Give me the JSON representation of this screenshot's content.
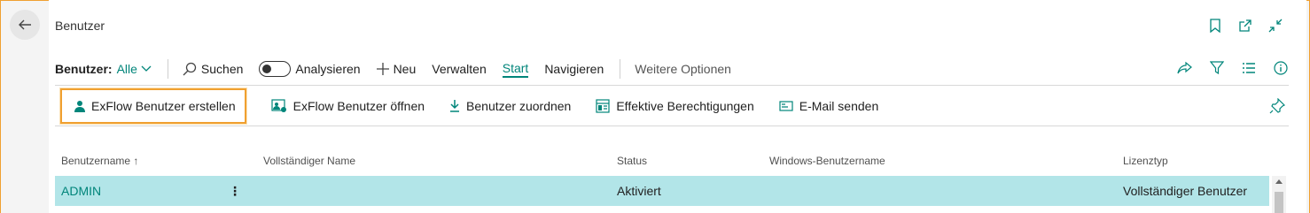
{
  "page": {
    "title": "Benutzer"
  },
  "actionbar": {
    "filter_label": "Benutzer:",
    "filter_value": "Alle",
    "search": "Suchen",
    "analyze": "Analysieren",
    "new": "Neu",
    "manage": "Verwalten",
    "start": "Start",
    "navigate": "Navigieren",
    "more": "Weitere Optionen"
  },
  "promoted": {
    "create": "ExFlow Benutzer erstellen",
    "open": "ExFlow Benutzer öffnen",
    "assign": "Benutzer zuordnen",
    "permissions": "Effektive Berechtigungen",
    "email": "E-Mail senden"
  },
  "table": {
    "columns": {
      "username": "Benutzername",
      "fullname": "Vollständiger Name",
      "status": "Status",
      "windows": "Windows-Benutzername",
      "license": "Lizenztyp"
    },
    "sort_indicator": "↑",
    "rows": [
      {
        "username": "ADMIN",
        "fullname": "",
        "status": "Aktiviert",
        "windows": "",
        "license": "Vollständiger Benutzer"
      }
    ]
  },
  "colors": {
    "accent": "#00857a",
    "highlight": "#f0a030",
    "selected_row": "#b2e5e8"
  }
}
